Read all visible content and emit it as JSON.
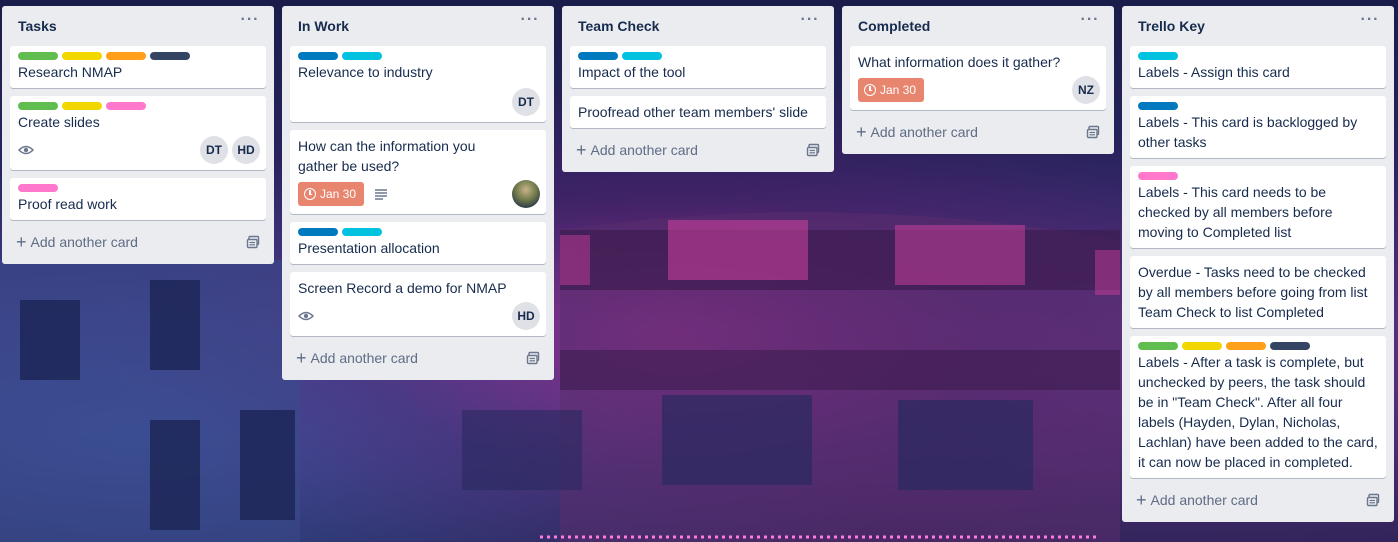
{
  "colors": {
    "green": "#61bd4f",
    "yellow": "#f2d600",
    "orange": "#ff9f1a",
    "navy": "#344563",
    "pink": "#ff78cb",
    "blue": "#0079bf",
    "sky": "#00c2e0"
  },
  "lists": [
    {
      "title": "Tasks",
      "cards": [
        {
          "labels": [
            "green",
            "yellow",
            "orange",
            "navy"
          ],
          "title": "Research NMAP"
        },
        {
          "labels": [
            "green",
            "yellow",
            "pink"
          ],
          "title": "Create slides",
          "watch": true,
          "members": [
            "DT",
            "HD"
          ]
        },
        {
          "labels": [
            "pink"
          ],
          "title": "Proof read work"
        }
      ],
      "add_label": "Add another card"
    },
    {
      "title": "In Work",
      "cards": [
        {
          "labels": [
            "blue",
            "sky"
          ],
          "title": "Relevance to industry",
          "members": [
            "DT"
          ]
        },
        {
          "labels": [],
          "title": "How can the information you gather be used?",
          "due": "Jan 30",
          "description": true,
          "photo_member": true
        },
        {
          "labels": [
            "blue",
            "sky"
          ],
          "title": "Presentation allocation"
        },
        {
          "labels": [],
          "title": "Screen Record a demo for NMAP",
          "watch": true,
          "members": [
            "HD"
          ]
        }
      ],
      "add_label": "Add another card"
    },
    {
      "title": "Team Check",
      "cards": [
        {
          "labels": [
            "blue",
            "sky"
          ],
          "title": "Impact of the tool"
        },
        {
          "labels": [],
          "title": "Proofread other team members' slide"
        }
      ],
      "add_label": "Add another card"
    },
    {
      "title": "Completed",
      "cards": [
        {
          "labels": [],
          "title": "What information does it gather?",
          "due": "Jan 30",
          "members": [
            "NZ"
          ]
        }
      ],
      "add_label": "Add another card"
    },
    {
      "title": "Trello Key",
      "cards": [
        {
          "labels": [
            "sky"
          ],
          "title": "Labels - Assign this card"
        },
        {
          "labels": [
            "blue"
          ],
          "title": "Labels - This card is backlogged by other tasks"
        },
        {
          "labels": [
            "pink"
          ],
          "title": "Labels - This card needs to be checked by all members before moving to Completed list"
        },
        {
          "labels": [],
          "title": "Overdue - Tasks need to be checked by all members before going from list Team Check to list Completed"
        },
        {
          "labels": [
            "green",
            "yellow",
            "orange",
            "navy"
          ],
          "title": "Labels - After a task is complete, but unchecked by peers, the task should be in \"Team Check\". After all four labels (Hayden, Dylan, Nicholas, Lachlan) have been added to the card, it can now be placed in completed."
        }
      ],
      "add_label": "Add another card"
    }
  ]
}
